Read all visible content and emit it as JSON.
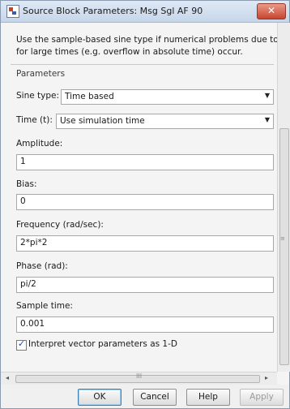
{
  "window": {
    "title": "Source Block Parameters: Msg Sgl AF 90",
    "close_label": "✕"
  },
  "description": {
    "line1": "Use the sample-based sine type if numerical problems due to running",
    "line2": "for large times (e.g. overflow in absolute time) occur."
  },
  "parameters_label": "Parameters",
  "sine_type": {
    "label": "Sine type:",
    "value": "Time based"
  },
  "time": {
    "label": "Time (t):",
    "value": "Use simulation time"
  },
  "amplitude": {
    "label": "Amplitude:",
    "value": "1"
  },
  "bias": {
    "label": "Bias:",
    "value": "0"
  },
  "frequency": {
    "label": "Frequency (rad/sec):",
    "value": "2*pi*2"
  },
  "phase": {
    "label": "Phase (rad):",
    "value": "pi/2"
  },
  "sample_time": {
    "label": "Sample time:",
    "value": "0.001"
  },
  "interpret_vector": {
    "label": "Interpret vector parameters as 1-D",
    "checked": true,
    "mark": "✓"
  },
  "scroll": {
    "left": "◂",
    "right": "▸",
    "hgrip": "III",
    "vgrip": "≡"
  },
  "buttons": {
    "ok": "OK",
    "cancel": "Cancel",
    "help": "Help",
    "apply": "Apply"
  },
  "dropdown_arrow": "▼"
}
